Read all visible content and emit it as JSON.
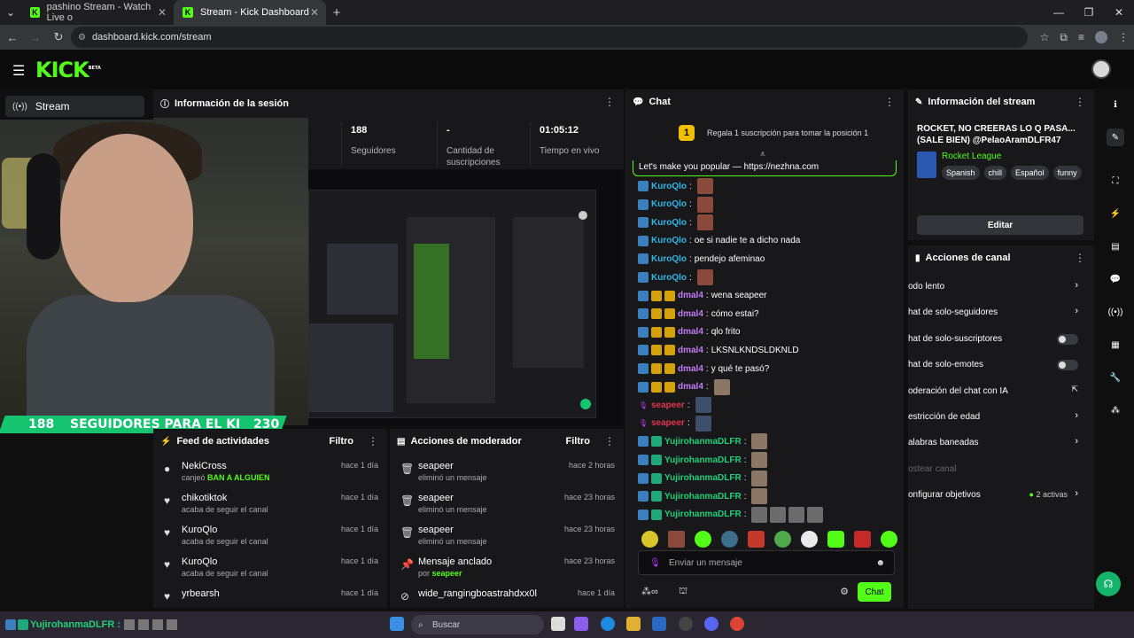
{
  "browser": {
    "tabs": [
      {
        "title": "pashino Stream - Watch Live o",
        "active": false
      },
      {
        "title": "Stream - Kick Dashboard",
        "active": true
      }
    ],
    "url": "dashboard.kick.com/stream"
  },
  "header": {
    "logo": "KICK",
    "beta": "BETA"
  },
  "nav": {
    "stream_label": "Stream"
  },
  "session": {
    "title": "Información de la sesión",
    "stats": [
      {
        "value": "188",
        "label": "Seguidores"
      },
      {
        "value": "-",
        "label": "Cantidad de suscripciones"
      },
      {
        "value": "01:05:12",
        "label": "Tiempo en vivo"
      }
    ]
  },
  "overlay": {
    "goal_count": "188",
    "goal_text": "SEGUIDORES PARA EL KI",
    "goal_target": "230"
  },
  "activity": {
    "title": "Feed de actividades",
    "filter": "Filtro",
    "items": [
      {
        "name": "NekiCross",
        "action": "canjeó",
        "highlight": "BAN A ALGUIEN",
        "time": "hace 1 día",
        "icon": "●"
      },
      {
        "name": "chikotiktok",
        "action": "acaba de seguir el canal",
        "highlight": "",
        "time": "hace 1 día",
        "icon": "♥"
      },
      {
        "name": "KuroQlo",
        "action": "acaba de seguir el canal",
        "highlight": "",
        "time": "hace 1 día",
        "icon": "♥"
      },
      {
        "name": "KuroQlo",
        "action": "acaba de seguir el canal",
        "highlight": "",
        "time": "hace 1 día",
        "icon": "♥"
      },
      {
        "name": "yrbearsh",
        "action": "",
        "highlight": "",
        "time": "hace 1 día",
        "icon": "♥"
      }
    ]
  },
  "moderator": {
    "title": "Acciones de moderador",
    "filter": "Filtro",
    "items": [
      {
        "name": "seapeer",
        "action": "eliminó un mensaje",
        "highlight": "",
        "time": "hace 2 horas",
        "icon": "🗑"
      },
      {
        "name": "seapeer",
        "action": "eliminó un mensaje",
        "highlight": "",
        "time": "hace 23 horas",
        "icon": "🗑"
      },
      {
        "name": "seapeer",
        "action": "eliminó un mensaje",
        "highlight": "",
        "time": "hace 23 horas",
        "icon": "🗑"
      },
      {
        "name": "Mensaje anclado",
        "action": "por",
        "highlight": "seapeer",
        "time": "hace 23 horas",
        "icon": "📌"
      },
      {
        "name": "wide_rangingboastrahdxx0l",
        "action": "",
        "highlight": "",
        "time": "hace 1 día",
        "icon": "⊘"
      }
    ]
  },
  "chat": {
    "title": "Chat",
    "promo_rank": "1",
    "promo_text": "Regala 1 suscripción para tomar la posición 1",
    "pinned": "Let's make you popular — https://nezhna.com",
    "messages": [
      {
        "user": "KuroQlo",
        "color": "#2fb5e6",
        "text": "",
        "badges": [
          "b"
        ],
        "emotes": 1,
        "em": "b1"
      },
      {
        "user": "KuroQlo",
        "color": "#2fb5e6",
        "text": "",
        "badges": [
          "b"
        ],
        "emotes": 1,
        "em": "b1"
      },
      {
        "user": "KuroQlo",
        "color": "#2fb5e6",
        "text": "",
        "badges": [
          "b"
        ],
        "emotes": 1,
        "em": "b1"
      },
      {
        "user": "KuroQlo",
        "color": "#2fb5e6",
        "text": "oe si nadie te a dicho nada",
        "badges": [
          "b"
        ],
        "emotes": 0,
        "em": ""
      },
      {
        "user": "KuroQlo",
        "color": "#2fb5e6",
        "text": "pendejo afeminao",
        "badges": [
          "b"
        ],
        "emotes": 0,
        "em": ""
      },
      {
        "user": "KuroQlo",
        "color": "#2fb5e6",
        "text": "",
        "badges": [
          "b"
        ],
        "emotes": 1,
        "em": "b1"
      },
      {
        "user": "dmal4",
        "color": "#c27cf4",
        "text": "wena seapeer",
        "badges": [
          "b",
          "gold",
          "gold"
        ],
        "emotes": 0,
        "em": ""
      },
      {
        "user": "dmal4",
        "color": "#c27cf4",
        "text": "cómo estai?",
        "badges": [
          "b",
          "gold",
          "gold"
        ],
        "emotes": 0,
        "em": ""
      },
      {
        "user": "dmal4",
        "color": "#c27cf4",
        "text": "qlo frito",
        "badges": [
          "b",
          "gold",
          "gold"
        ],
        "emotes": 0,
        "em": ""
      },
      {
        "user": "dmal4",
        "color": "#c27cf4",
        "text": "LKSNLKNDSLDKNLD",
        "badges": [
          "b",
          "gold",
          "gold"
        ],
        "emotes": 0,
        "em": ""
      },
      {
        "user": "dmal4",
        "color": "#c27cf4",
        "text": "y qué te pasó?",
        "badges": [
          "b",
          "gold",
          "gold"
        ],
        "emotes": 0,
        "em": ""
      },
      {
        "user": "dmal4",
        "color": "#c27cf4",
        "text": "",
        "badges": [
          "b",
          "gold",
          "gold"
        ],
        "emotes": 1,
        "em": "b2"
      },
      {
        "user": "seapeer",
        "color": "#e0344f",
        "text": "",
        "badges": [
          "mic"
        ],
        "emotes": 1,
        "em": "b3"
      },
      {
        "user": "seapeer",
        "color": "#e0344f",
        "text": "",
        "badges": [
          "mic"
        ],
        "emotes": 1,
        "em": "b3"
      },
      {
        "user": "YujirohanmaDLFR",
        "color": "#1fd07b",
        "text": "",
        "badges": [
          "b",
          "green"
        ],
        "emotes": 1,
        "em": "b2"
      },
      {
        "user": "YujirohanmaDLFR",
        "color": "#1fd07b",
        "text": "",
        "badges": [
          "b",
          "green"
        ],
        "emotes": 1,
        "em": "b2"
      },
      {
        "user": "YujirohanmaDLFR",
        "color": "#1fd07b",
        "text": "",
        "badges": [
          "b",
          "green"
        ],
        "emotes": 1,
        "em": "b2"
      },
      {
        "user": "YujirohanmaDLFR",
        "color": "#1fd07b",
        "text": "",
        "badges": [
          "b",
          "green"
        ],
        "emotes": 1,
        "em": "b2"
      },
      {
        "user": "YujirohanmaDLFR",
        "color": "#1fd07b",
        "text": "",
        "badges": [
          "b",
          "green"
        ],
        "emotes": 4,
        "em": "b4"
      }
    ],
    "input_placeholder": "Enviar un mensaje",
    "send_label": "Chat"
  },
  "stream_info": {
    "title": "Información del stream",
    "stream_title": "ROCKET, NO CREERAS LO Q PASA... (SALE BIEN) @PelaoAramDLFR47",
    "game": "Rocket League",
    "tags": [
      "Spanish",
      "chill",
      "Español",
      "funny"
    ],
    "edit_label": "Editar"
  },
  "channel_actions": {
    "title": "Acciones de canal",
    "items": [
      {
        "label": "odo lento",
        "control": "chevron"
      },
      {
        "label": "hat de solo-seguidores",
        "control": "chevron"
      },
      {
        "label": "hat de solo-suscriptores",
        "control": "toggle"
      },
      {
        "label": "hat de solo-emotes",
        "control": "toggle"
      },
      {
        "label": "oderación del chat con IA",
        "control": "external"
      },
      {
        "label": "estricción de edad",
        "control": "chevron"
      },
      {
        "label": "alabras baneadas",
        "control": "chevron"
      },
      {
        "label": "ostear canal",
        "control": "none"
      },
      {
        "label": "onfigurar objetivos",
        "control": "chevron",
        "extra": "2 activas"
      }
    ]
  },
  "taskbar": {
    "search_placeholder": "Buscar"
  },
  "overlay_chat": {
    "user": "YujirohanmaDLFR :"
  },
  "colors": {
    "accent": "#53fc18",
    "panel": "#18181b"
  }
}
